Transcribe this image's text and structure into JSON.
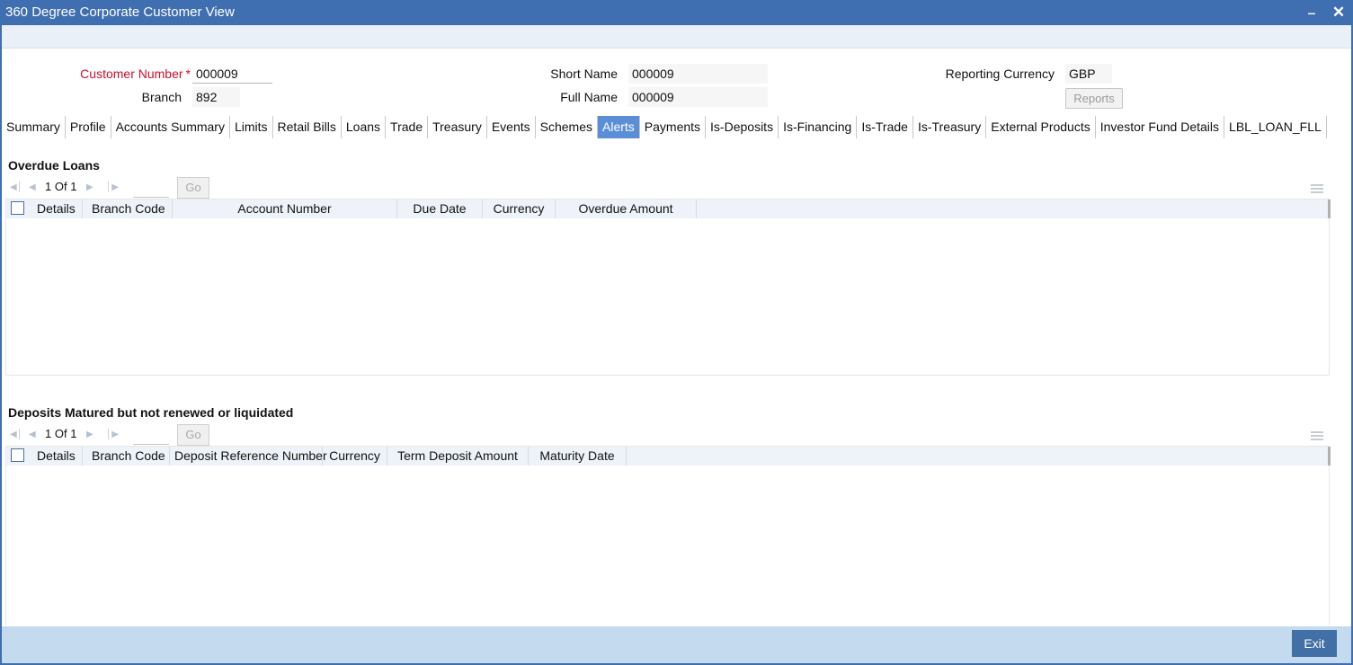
{
  "window": {
    "title": "360 Degree Corporate Customer View",
    "minimize_glyph": "‒",
    "close_glyph": "✕"
  },
  "header": {
    "customer_number_label": "Customer Number",
    "required_mark": "*",
    "customer_number_value": "000009",
    "branch_label": "Branch",
    "branch_value": "892",
    "short_name_label": "Short Name",
    "short_name_value": "000009",
    "full_name_label": "Full Name",
    "full_name_value": "000009",
    "reporting_currency_label": "Reporting Currency",
    "reporting_currency_value": "GBP",
    "reports_button": "Reports"
  },
  "tabs": [
    {
      "label": "Summary"
    },
    {
      "label": "Profile"
    },
    {
      "label": "Accounts Summary"
    },
    {
      "label": "Limits"
    },
    {
      "label": "Retail Bills"
    },
    {
      "label": "Loans"
    },
    {
      "label": "Trade"
    },
    {
      "label": "Treasury"
    },
    {
      "label": "Events"
    },
    {
      "label": "Schemes"
    },
    {
      "label": "Alerts",
      "active": true
    },
    {
      "label": "Payments"
    },
    {
      "label": "Is-Deposits"
    },
    {
      "label": "Is-Financing"
    },
    {
      "label": "Is-Trade"
    },
    {
      "label": "Is-Treasury"
    },
    {
      "label": "External Products"
    },
    {
      "label": "Investor Fund Details"
    },
    {
      "label": "LBL_LOAN_FLL"
    }
  ],
  "overdue_loans": {
    "title": "Overdue Loans",
    "pager": {
      "current": "1",
      "of_label": "Of",
      "total": "1",
      "go_label": "Go"
    },
    "columns": [
      "Details",
      "Branch Code",
      "Account Number",
      "Due Date",
      "Currency",
      "Overdue Amount"
    ]
  },
  "deposits_matured": {
    "title": "Deposits Matured but not renewed or liquidated",
    "pager": {
      "current": "1",
      "of_label": "Of",
      "total": "1",
      "go_label": "Go"
    },
    "columns": [
      "Details",
      "Branch Code",
      "Deposit Reference Number",
      "Currency",
      "Term Deposit Amount",
      "Maturity Date"
    ]
  },
  "footer": {
    "exit_button": "Exit"
  },
  "colors": {
    "title_bar": "#3f6fb0",
    "active_tab": "#5b8ed6",
    "footer": "#c4daee",
    "exit_button": "#416fa6",
    "required_label": "#c8102e"
  }
}
